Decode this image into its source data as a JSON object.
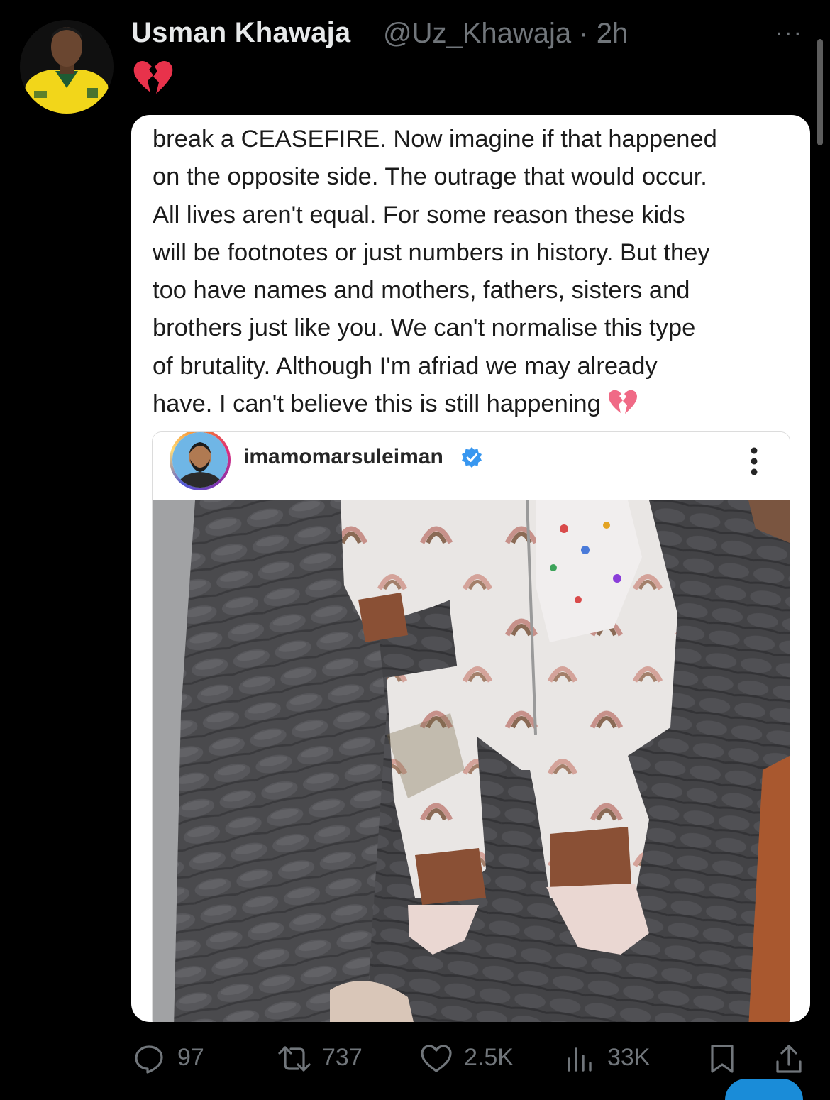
{
  "tweet": {
    "author_name": "Usman Khawaja",
    "handle_and_time": "@Uz_Khawaja · 2h",
    "more_label": "···",
    "emoji": "broken-heart",
    "screenshot_text_lines": [
      "break a CEASEFIRE. Now imagine if that happened",
      "on the opposite side. The outrage that would occur.",
      "All lives aren't equal. For some reason these kids",
      "will be footnotes or just numbers in history. But they",
      "too have names and mothers, fathers, sisters and",
      "brothers just like you. We can't normalise this type",
      "of brutality. Although I'm afriad we may already",
      "have. I can't believe this is still happening"
    ],
    "instagram": {
      "username": "imamomarsuleiman",
      "verified_icon": "verified-badge-icon",
      "photo_alt": "baby in rainbow-print onesie on grey blanket"
    }
  },
  "actions": {
    "replies": "97",
    "reposts": "737",
    "likes": "2.5K",
    "views": "33K"
  },
  "colors": {
    "background": "#000000",
    "primary_text": "#e7e9ea",
    "secondary_text": "#71767b",
    "card_bg": "#ffffff",
    "ig_verified": "#3897f0"
  }
}
